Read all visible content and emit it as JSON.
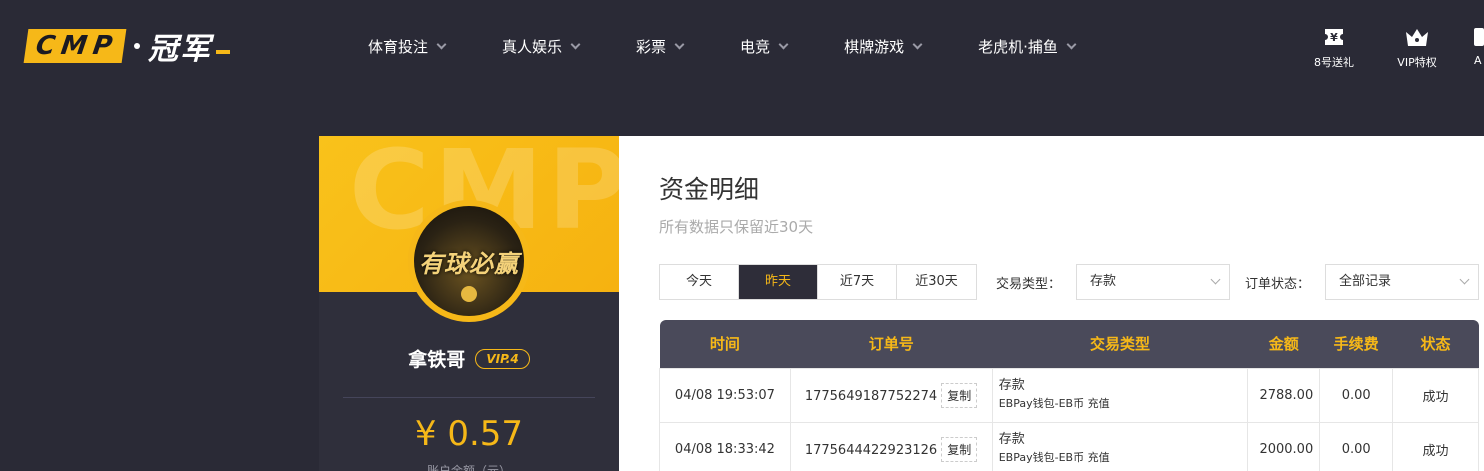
{
  "brand": {
    "logo_en": "CMP",
    "logo_cn": "冠军"
  },
  "nav": [
    {
      "label": "体育投注"
    },
    {
      "label": "真人娱乐"
    },
    {
      "label": "彩票"
    },
    {
      "label": "电竞"
    },
    {
      "label": "棋牌游戏"
    },
    {
      "label": "老虎机·捕鱼"
    }
  ],
  "top_actions": [
    {
      "label": "8号送礼",
      "icon": "ticket-icon"
    },
    {
      "label": "VIP特权",
      "icon": "crown-icon"
    },
    {
      "label": "A",
      "icon": "app-icon"
    }
  ],
  "profile": {
    "banner_watermark": "CMP",
    "avatar_text": "有球必赢",
    "username": "拿铁哥",
    "vip": "VIP.4",
    "balance": "¥ 0.57",
    "balance_label": "账户余额（元）"
  },
  "main": {
    "title": "资金明细",
    "subtitle": "所有数据只保留近30天",
    "ranges": [
      "今天",
      "昨天",
      "近7天",
      "近30天"
    ],
    "active_range": "昨天",
    "filters": {
      "type_label": "交易类型：",
      "type_value": "存款",
      "status_label": "订单状态：",
      "status_value": "全部记录"
    },
    "table": {
      "headers": [
        "时间",
        "订单号",
        "交易类型",
        "金额",
        "手续费",
        "状态"
      ],
      "copy_label": "复制",
      "rows": [
        {
          "time": "04/08 19:53:07",
          "order": "1775649187752274",
          "type": "存款",
          "type_detail": "EBPay钱包-EB币 充值",
          "amount": "2788.00",
          "fee": "0.00",
          "status": "成功"
        },
        {
          "time": "04/08 18:33:42",
          "order": "1775644422923126",
          "type": "存款",
          "type_detail": "EBPay钱包-EB币 充值",
          "amount": "2000.00",
          "fee": "0.00",
          "status": "成功"
        }
      ]
    }
  },
  "colors": {
    "accent": "#f6b818",
    "bg_dark": "#2a2a36",
    "success": "#3aa33a"
  }
}
